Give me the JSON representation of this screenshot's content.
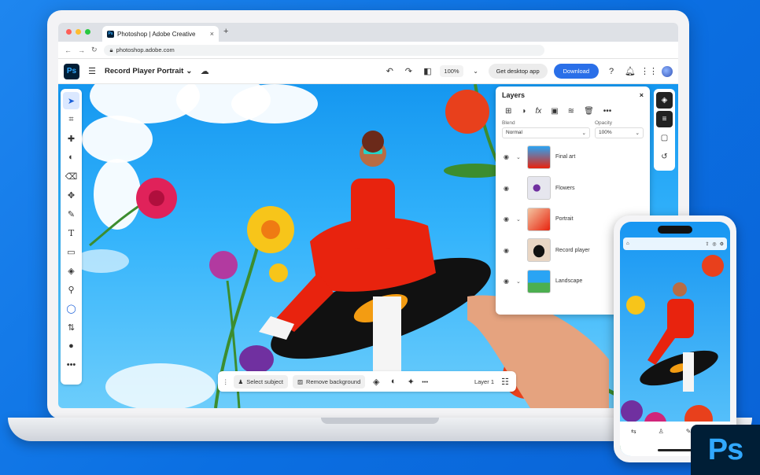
{
  "browser": {
    "tab_title": "Photoshop | Adobe Creative",
    "tab_close": "×",
    "new_tab": "+",
    "url": "photoshop.adobe.com"
  },
  "appbar": {
    "logo": "Ps",
    "document_name": "Record Player Portrait",
    "zoom": "100%",
    "get_desktop_label": "Get desktop app",
    "download_label": "Download"
  },
  "layers_panel": {
    "title": "Layers",
    "close": "×",
    "blend_label": "Blend",
    "blend_value": "Normal",
    "opacity_label": "Opacity",
    "opacity_value": "100%",
    "layers": [
      {
        "name": "Final art",
        "has_group": true
      },
      {
        "name": "Flowers",
        "has_group": false
      },
      {
        "name": "Portrait",
        "has_group": true
      },
      {
        "name": "Record player",
        "has_group": false
      },
      {
        "name": "Landscape",
        "has_group": true
      }
    ]
  },
  "taskbar": {
    "select_subject": "Select subject",
    "remove_background": "Remove background",
    "more": "•••",
    "layer_label": "Layer 1"
  },
  "badge": {
    "logo": "Ps"
  },
  "colors": {
    "accent": "#2a6fe8",
    "ps_dark": "#001e36",
    "ps_blue": "#31a8ff",
    "sky": "#1597f0"
  },
  "icons": {
    "left_tools": [
      "move-icon",
      "crop-icon",
      "heal-icon",
      "adjust-icon",
      "eraser-icon",
      "clone-icon",
      "brush-icon",
      "text-icon",
      "shape-icon",
      "fill-icon",
      "eyedropper-icon",
      "circle-icon",
      "swap-icon",
      "color-icon",
      "more-icon"
    ],
    "right_tools": [
      "layers-icon",
      "properties-icon",
      "comments-icon",
      "history-icon"
    ]
  }
}
